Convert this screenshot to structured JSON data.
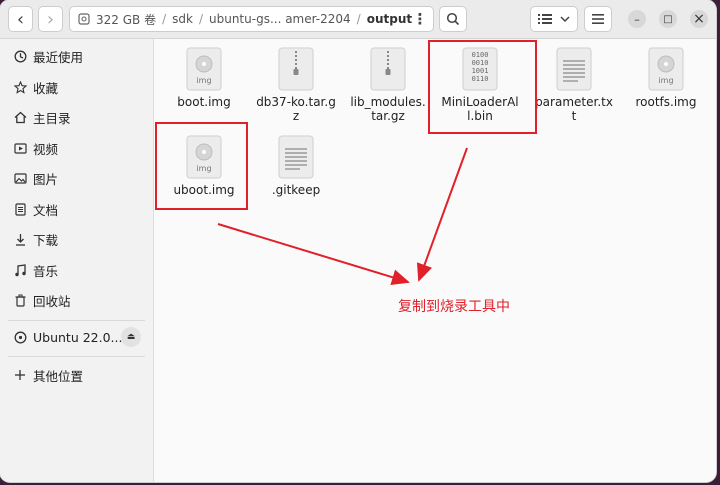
{
  "header": {
    "back_label": "‹",
    "forward_label": "›",
    "path": [
      "322 GB 卷",
      "sdk",
      "ubuntu-gs... amer-2204",
      "output"
    ],
    "menu_label": "⋮",
    "window": {
      "minimize": "–",
      "maximize": "□",
      "close": "×"
    }
  },
  "sidebar": {
    "items": [
      {
        "label": "最近使用",
        "icon": "clock-icon"
      },
      {
        "label": "收藏",
        "icon": "star-icon"
      },
      {
        "label": "主目录",
        "icon": "home-icon"
      },
      {
        "label": "视频",
        "icon": "video-icon"
      },
      {
        "label": "图片",
        "icon": "picture-icon"
      },
      {
        "label": "文档",
        "icon": "document-icon"
      },
      {
        "label": "下载",
        "icon": "download-icon"
      },
      {
        "label": "音乐",
        "icon": "music-icon"
      },
      {
        "label": "回收站",
        "icon": "trash-icon"
      }
    ],
    "drive": {
      "label": "Ubuntu 22.0...",
      "icon": "disk-icon",
      "eject": "⏏"
    },
    "other": {
      "label": "其他位置",
      "icon": "plus-icon"
    }
  },
  "files": [
    {
      "name": "boot.img",
      "type": "img"
    },
    {
      "name": "db37-ko.tar.gz",
      "type": "archive"
    },
    {
      "name": "lib_modules.tar.gz",
      "type": "archive"
    },
    {
      "name": "MiniLoaderAll.bin",
      "type": "binary"
    },
    {
      "name": "parameter.txt",
      "type": "text"
    },
    {
      "name": "rootfs.img",
      "type": "img"
    },
    {
      "name": "uboot.img",
      "type": "img"
    },
    {
      "name": ".gitkeep",
      "type": "text"
    }
  ],
  "annotation": {
    "text": "复制到烧录工具中",
    "color": "#e0202a"
  },
  "img_tag": "img",
  "bin_text": "0100\n0010\n1001\n0110"
}
